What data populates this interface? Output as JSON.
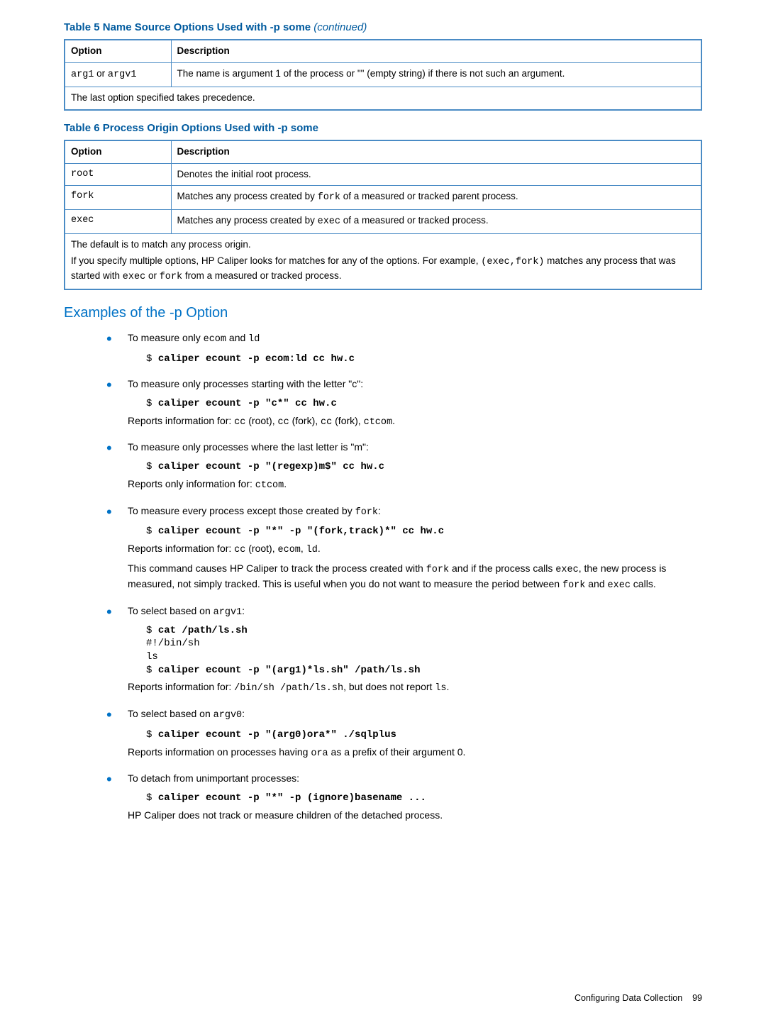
{
  "table5": {
    "title_prefix": "Table 5 Name Source Options Used with -p some ",
    "title_suffix": "(continued)",
    "headers": {
      "option": "Option",
      "description": "Description"
    },
    "rows": [
      {
        "opt": "arg1",
        "or": " or ",
        "opt2": "argv1",
        "desc": "The name is argument 1 of the process or \"\" (empty string) if there is not such an argument."
      }
    ],
    "footer": "The last option specified takes precedence."
  },
  "table6": {
    "title": "Table 6 Process Origin Options Used with -p some",
    "headers": {
      "option": "Option",
      "description": "Description"
    },
    "rows": [
      {
        "opt": "root",
        "desc": "Denotes the initial root process."
      },
      {
        "opt": "fork",
        "descA": "Matches any process created by ",
        "descMono": "fork",
        "descB": " of a measured or tracked parent process."
      },
      {
        "opt": "exec",
        "descA": "Matches any process created by ",
        "descMono": "exec",
        "descB": " of a measured or tracked process."
      }
    ],
    "footer1": "The default is to match any process origin.",
    "footer2a": "If you specify multiple options, HP Caliper looks for matches for any of the options. For example, ",
    "footer2mono": "(exec,fork)",
    "footer2b": " matches any process that was started with ",
    "footer2c": "exec",
    "footer2d": " or ",
    "footer2e": "fork",
    "footer2f": " from a measured or tracked process."
  },
  "section_heading": "Examples of the -p Option",
  "examples": [
    {
      "intro_a": "To measure only ",
      "intro_m1": "ecom",
      "intro_b": " and ",
      "intro_m2": "ld",
      "prompt": "$ ",
      "cmd": " caliper ecount -p ecom:ld cc hw.c"
    },
    {
      "intro_a": "To measure only processes starting with the letter \"c\":",
      "prompt": "$ ",
      "cmd": " caliper ecount -p \"c*\" cc hw.c",
      "desc_a": "Reports information for: ",
      "desc_m1": "cc",
      "desc_b": " (root), ",
      "desc_m2": "cc",
      "desc_c": " (fork), ",
      "desc_m3": "cc",
      "desc_d": " (fork), ",
      "desc_m4": "ctcom",
      "desc_e": "."
    },
    {
      "intro_a": "To measure only processes where the last letter is \"m\":",
      "prompt": "$ ",
      "cmd": " caliper ecount -p \"(regexp)m$\" cc hw.c",
      "desc_a": "Reports only information for: ",
      "desc_m1": "ctcom",
      "desc_b": "."
    },
    {
      "intro_a": "To measure every process except those created by ",
      "intro_m1": "fork",
      "intro_b": ":",
      "prompt": "$ ",
      "cmd": " caliper ecount -p \"*\" -p \"(fork,track)*\" cc hw.c",
      "desc_a": "Reports information for: ",
      "desc_m1": "cc",
      "desc_b": " (root), ",
      "desc_m2": "ecom",
      "desc_c": ", ",
      "desc_m3": "ld",
      "desc_d": ".",
      "para_a": "This command causes HP Caliper to track the process created with ",
      "para_m1": "fork",
      "para_b": " and if the process calls ",
      "para_m2": "exec",
      "para_c": ", the new process is measured, not simply tracked. This is useful when you do not want to measure the period between ",
      "para_m3": "fork",
      "para_d": " and ",
      "para_m4": "exec",
      "para_e": " calls."
    },
    {
      "intro_a": "To select based on ",
      "intro_m1": "argv1",
      "intro_b": ":",
      "codeblock_b1": "$ ",
      "codeblock_b1t": "cat /path/ls.sh",
      "codeblock_l2": "#!/bin/sh",
      "codeblock_l3": "ls",
      "codeblock_b4": "$ ",
      "codeblock_b4t": "caliper ecount -p \"(arg1)*ls.sh\" /path/ls.sh",
      "desc_a": "Reports information for: ",
      "desc_m1": "/bin/sh /path/ls.sh",
      "desc_b": ", but does not report ",
      "desc_m2": "ls",
      "desc_c": "."
    },
    {
      "intro_a": "To select based on ",
      "intro_m1": "argv0",
      "intro_b": ":",
      "prompt": "$ ",
      "cmd": " caliper ecount -p \"(arg0)ora*\" ./sqlplus",
      "desc_a": "Reports information on processes having ",
      "desc_m1": "ora",
      "desc_b": " as a prefix of their argument 0."
    },
    {
      "intro_a": "To detach from unimportant processes:",
      "prompt": "$ ",
      "cmd": " caliper ecount -p \"*\" -p (ignore)basename ...",
      "desc_a": "HP Caliper does not track or measure children of the detached process."
    }
  ],
  "page_footer": {
    "label": "Configuring Data Collection",
    "num": "99"
  }
}
